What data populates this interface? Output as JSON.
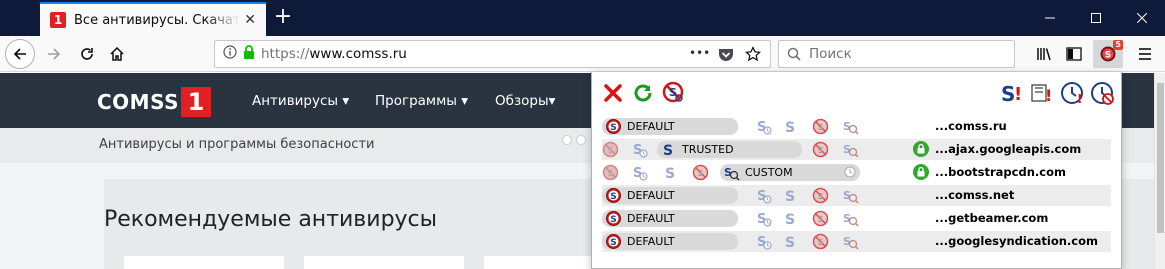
{
  "browser": {
    "tab": {
      "favicon": "1",
      "title": "Все антивирусы. Скачать бесплатные антивирусы"
    },
    "new_tab_symbol": "+",
    "url": {
      "scheme": "https://",
      "host": "www.comss.ru"
    },
    "search_placeholder": "Поиск",
    "extension_badge": "5",
    "page_actions_symbol": "•••"
  },
  "site": {
    "logo_text": "COMSS",
    "logo_number": "1",
    "menu": [
      {
        "label": "Антивирусы ▾"
      },
      {
        "label": "Программы ▾"
      },
      {
        "label": "Обзоры▾"
      }
    ],
    "tagline": "Антивирусы и программы безопасности",
    "section_title": "Рекомендуемые антивирусы"
  },
  "popup": {
    "rows": [
      {
        "domain": "...comss.ru",
        "status": "DEFAULT",
        "kind": "default",
        "https": false
      },
      {
        "domain": "...ajax.googleapis.com",
        "status": "TRUSTED",
        "kind": "trusted",
        "https": true
      },
      {
        "domain": "...bootstrapcdn.com",
        "status": "CUSTOM",
        "kind": "custom",
        "https": true
      },
      {
        "domain": "...comss.net",
        "status": "DEFAULT",
        "kind": "default",
        "https": false
      },
      {
        "domain": "...getbeamer.com",
        "status": "DEFAULT",
        "kind": "default",
        "https": false
      },
      {
        "domain": "...googlesyndication.com",
        "status": "DEFAULT",
        "kind": "default",
        "https": false
      }
    ]
  },
  "colors": {
    "titlebar": "#0e1a3a",
    "accent": "#0a84ff",
    "site_header": "#2a3340",
    "brand_red": "#e31f26",
    "lock_green": "#2fa82f"
  }
}
